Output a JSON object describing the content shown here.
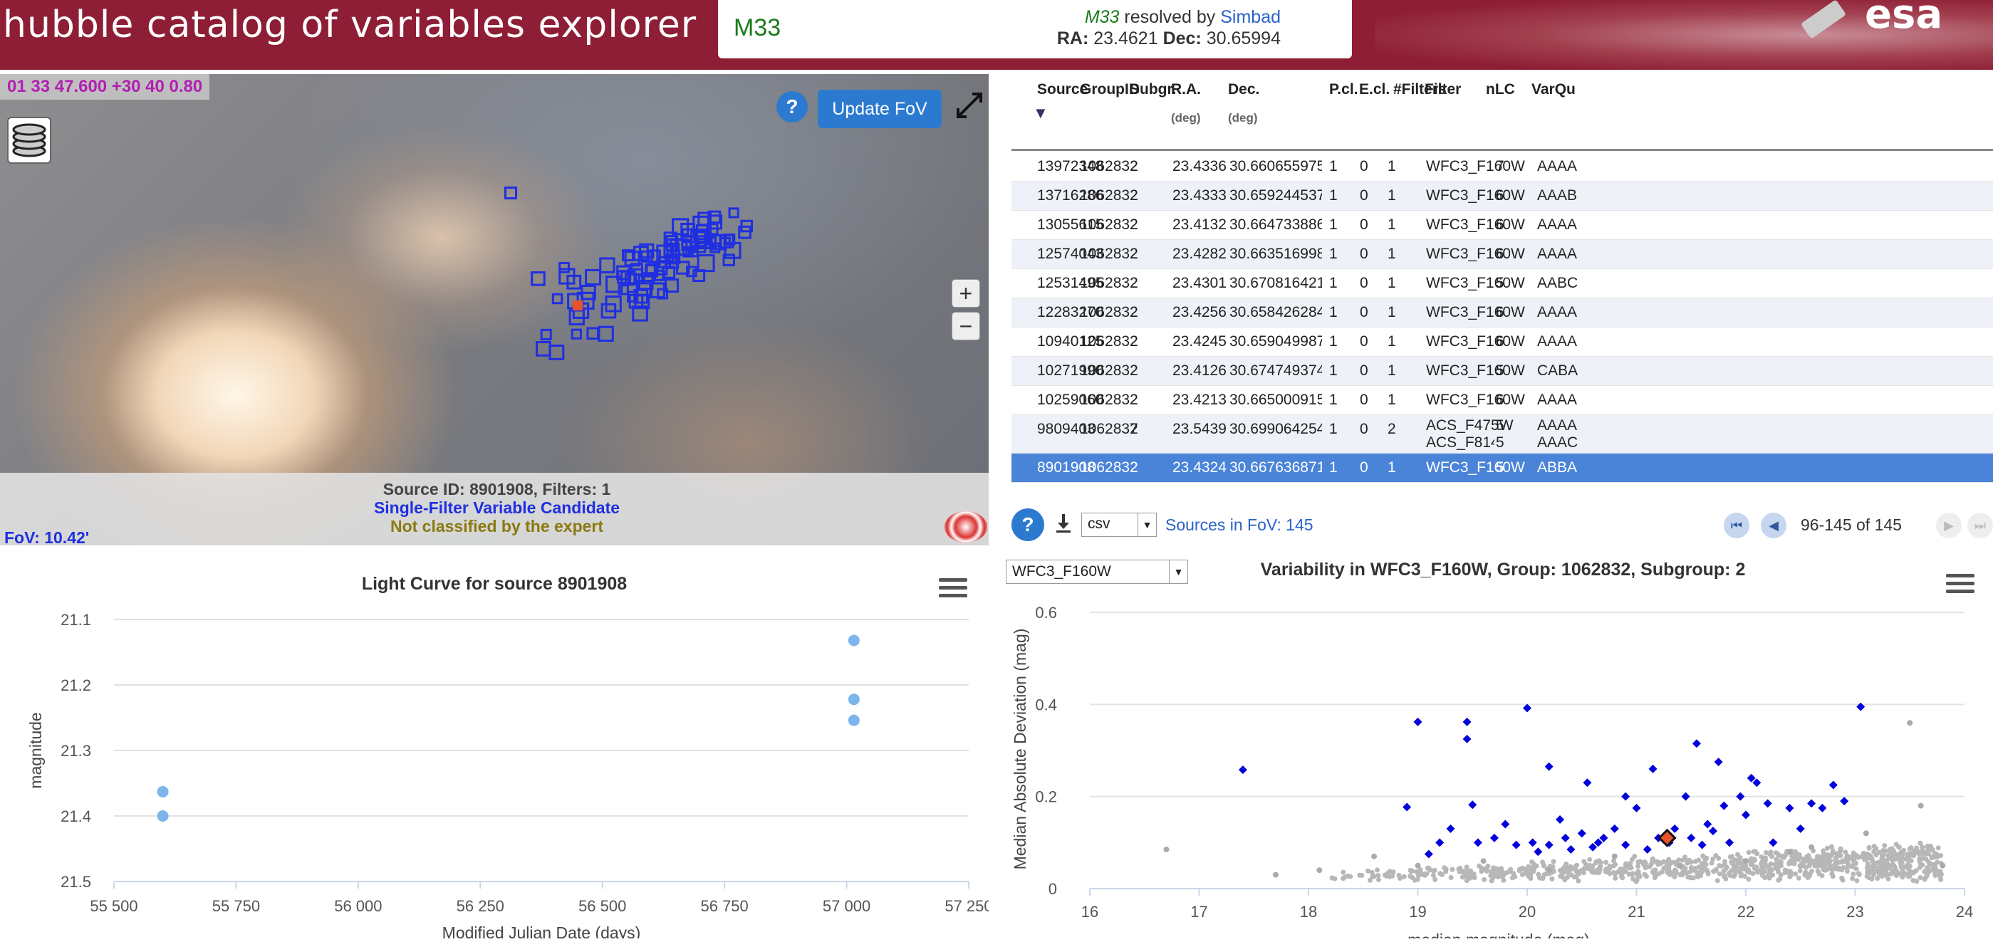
{
  "header": {
    "app_title": "hubble catalog of variables explorer",
    "search_value": "M33",
    "resolver_object": "M33",
    "resolver_text": "resolved by",
    "resolver_service": "Simbad",
    "ra_label": "RA:",
    "ra_value": "23.4621",
    "dec_label": "Dec:",
    "dec_value": "30.65994",
    "logo_text": "esa"
  },
  "sky_view": {
    "coordinates": "01 33 47.600 +30 40 0.80",
    "help_label": "?",
    "update_fov_label": "Update FoV",
    "zoom_in_label": "+",
    "zoom_out_label": "−",
    "source_info_line1": "Source ID: 8901908, Filters: 1",
    "source_info_line2": "Single-Filter Variable Candidate",
    "source_info_line3": "Not classified by the expert",
    "fov": "FoV: 10.42'"
  },
  "table": {
    "columns": [
      {
        "label": "Source",
        "unit": ""
      },
      {
        "label": "GroupID",
        "unit": ""
      },
      {
        "label": "Subgr.",
        "unit": ""
      },
      {
        "label": "R.A.",
        "unit": "(deg)"
      },
      {
        "label": "Dec.",
        "unit": "(deg)"
      },
      {
        "label": "P.cl.",
        "unit": ""
      },
      {
        "label": "E.cl.",
        "unit": ""
      },
      {
        "label": "#Filters",
        "unit": ""
      },
      {
        "label": "Filter",
        "unit": ""
      },
      {
        "label": "nLC",
        "unit": ""
      },
      {
        "label": "VarQu",
        "unit": ""
      }
    ],
    "rows": [
      {
        "source": "13972348",
        "group": "1062832",
        "subgr": "2",
        "ra": "23.4336471558",
        "dec": "30.6606559753",
        "pcl": "1",
        "ecl": "0",
        "nfilters": "1",
        "filter": "WFC3_F160W",
        "nlc": "7",
        "varqu": "AAAA"
      },
      {
        "source": "13716286",
        "group": "1062832",
        "subgr": "2",
        "ra": "23.4333209991",
        "dec": "30.6592445374",
        "pcl": "1",
        "ecl": "0",
        "nfilters": "1",
        "filter": "WFC3_F160W",
        "nlc": "6",
        "varqu": "AAAB"
      },
      {
        "source": "13055615",
        "group": "1062832",
        "subgr": "2",
        "ra": "23.4132061005",
        "dec": "30.6647338867",
        "pcl": "1",
        "ecl": "0",
        "nfilters": "1",
        "filter": "WFC3_F160W",
        "nlc": "6",
        "varqu": "AAAA"
      },
      {
        "source": "12574043",
        "group": "1062832",
        "subgr": "2",
        "ra": "23.4282131195",
        "dec": "30.6635169983",
        "pcl": "1",
        "ecl": "0",
        "nfilters": "1",
        "filter": "WFC3_F160W",
        "nlc": "6",
        "varqu": "AAAA"
      },
      {
        "source": "12531495",
        "group": "1062832",
        "subgr": "2",
        "ra": "23.4301815033",
        "dec": "30.6708164215",
        "pcl": "1",
        "ecl": "0",
        "nfilters": "1",
        "filter": "WFC3_F160W",
        "nlc": "5",
        "varqu": "AABC"
      },
      {
        "source": "12283270",
        "group": "1062832",
        "subgr": "2",
        "ra": "23.4256610870",
        "dec": "30.6584262848",
        "pcl": "1",
        "ecl": "0",
        "nfilters": "1",
        "filter": "WFC3_F160W",
        "nlc": "6",
        "varqu": "AAAA"
      },
      {
        "source": "10940125",
        "group": "1062832",
        "subgr": "2",
        "ra": "23.4245777130",
        "dec": "30.6590499878",
        "pcl": "1",
        "ecl": "0",
        "nfilters": "1",
        "filter": "WFC3_F160W",
        "nlc": "6",
        "varqu": "AAAA"
      },
      {
        "source": "10271990",
        "group": "1062832",
        "subgr": "2",
        "ra": "23.4126739502",
        "dec": "30.6747493744",
        "pcl": "1",
        "ecl": "0",
        "nfilters": "1",
        "filter": "WFC3_F160W",
        "nlc": "5",
        "varqu": "CABA"
      },
      {
        "source": "10259060",
        "group": "1062832",
        "subgr": "2",
        "ra": "23.4213886261",
        "dec": "30.6650009155",
        "pcl": "1",
        "ecl": "0",
        "nfilters": "1",
        "filter": "WFC3_F160W",
        "nlc": "6",
        "varqu": "AAAA"
      },
      {
        "source": "9809403",
        "group": "1062832",
        "subgr": "7",
        "ra": "23.5439643860",
        "dec": "30.6990642548",
        "pcl": "1",
        "ecl": "0",
        "nfilters": "2",
        "filter": "ACS_F475W",
        "filter2": "ACS_F814W",
        "nlc": "5",
        "nlc2": "5",
        "varqu": "AAAA",
        "varqu2": "AAAC"
      },
      {
        "source": "8901908",
        "group": "1062832",
        "subgr": "2",
        "ra": "23.4324779510",
        "dec": "30.6676368713",
        "pcl": "1",
        "ecl": "0",
        "nfilters": "1",
        "filter": "WFC3_F160W",
        "nlc": "5",
        "varqu": "ABBA"
      }
    ],
    "format_value": "csv",
    "sources_in_fov": "Sources in FoV: 145",
    "pager": "96-145 of 145"
  },
  "light_curve": {
    "title": "Light Curve for source 8901908",
    "xlabel": "Modified Julian Date (days)",
    "ylabel": "magnitude"
  },
  "variability": {
    "filter_value": "WFC3_F160W",
    "title": "Variability in WFC3_F160W, Group: 1062832, Subgroup: 2",
    "xlabel": "median magnitude (mag)",
    "ylabel": "Median Absolute Deviation (mag)"
  },
  "colors": {
    "header_bg": "#8e1e35",
    "accent": "#2c7ad0",
    "selected_row": "#4a84d8",
    "lc_points": "#7cb5ec",
    "variable_points": "#0000dd",
    "field_points": "#aaaaaa",
    "highlight_point": "#e8532b"
  },
  "chart_data": [
    {
      "type": "scatter",
      "title": "Light Curve for source 8901908",
      "xlabel": "Modified Julian Date (days)",
      "ylabel": "magnitude",
      "xlim": [
        55500,
        57250
      ],
      "ylim": [
        21.5,
        21.1
      ],
      "y_reversed": true,
      "x_ticks": [
        55500,
        55750,
        56000,
        56250,
        56500,
        56750,
        57000,
        57250
      ],
      "x_tick_labels": [
        "55 500",
        "55 750",
        "56 000",
        "56 250",
        "56 500",
        "56 750",
        "57 000",
        "57 250"
      ],
      "y_ticks": [
        21.1,
        21.2,
        21.3,
        21.4,
        21.5
      ],
      "series": [
        {
          "x": [
            55600,
            55600,
            57015,
            57015,
            57015
          ],
          "y": [
            21.363,
            21.4,
            21.132,
            21.222,
            21.254
          ]
        }
      ]
    },
    {
      "type": "scatter",
      "title": "Variability in WFC3_F160W, Group: 1062832, Subgroup: 2",
      "xlabel": "median magnitude (mag)",
      "ylabel": "Median Absolute Deviation (mag)",
      "xlim": [
        16,
        24
      ],
      "ylim": [
        0,
        0.6
      ],
      "x_ticks": [
        16,
        17,
        18,
        19,
        20,
        21,
        22,
        23,
        24
      ],
      "y_ticks": [
        0,
        0.2,
        0.4,
        0.6
      ],
      "series": [
        {
          "points": [
            [
              17.4,
              0.258
            ],
            [
              18.9,
              0.177
            ],
            [
              19.0,
              0.362
            ],
            [
              19.1,
              0.075
            ],
            [
              19.2,
              0.1
            ],
            [
              19.3,
              0.13
            ],
            [
              19.45,
              0.362
            ],
            [
              19.45,
              0.325
            ],
            [
              19.5,
              0.182
            ],
            [
              19.55,
              0.1
            ],
            [
              19.7,
              0.11
            ],
            [
              19.8,
              0.14
            ],
            [
              19.9,
              0.095
            ],
            [
              20.0,
              0.392
            ],
            [
              20.05,
              0.1
            ],
            [
              20.1,
              0.08
            ],
            [
              20.2,
              0.095
            ],
            [
              20.3,
              0.15
            ],
            [
              20.35,
              0.11
            ],
            [
              20.4,
              0.085
            ],
            [
              20.5,
              0.12
            ],
            [
              20.6,
              0.09
            ],
            [
              20.65,
              0.1
            ],
            [
              20.7,
              0.11
            ],
            [
              20.8,
              0.13
            ],
            [
              20.9,
              0.095
            ],
            [
              21.0,
              0.175
            ],
            [
              21.1,
              0.085
            ],
            [
              21.2,
              0.11
            ],
            [
              21.3,
              0.1
            ],
            [
              21.35,
              0.13
            ],
            [
              21.45,
              0.2
            ],
            [
              21.5,
              0.11
            ],
            [
              21.6,
              0.095
            ],
            [
              21.65,
              0.14
            ],
            [
              21.7,
              0.125
            ],
            [
              21.8,
              0.18
            ],
            [
              21.85,
              0.1
            ],
            [
              21.95,
              0.2
            ],
            [
              22.0,
              0.16
            ],
            [
              22.1,
              0.23
            ],
            [
              22.2,
              0.185
            ],
            [
              22.25,
              0.1
            ],
            [
              22.4,
              0.175
            ],
            [
              22.5,
              0.13
            ],
            [
              22.6,
              0.185
            ],
            [
              22.7,
              0.175
            ],
            [
              22.8,
              0.225
            ],
            [
              22.9,
              0.19
            ],
            [
              23.05,
              0.395
            ],
            [
              20.9,
              0.2
            ],
            [
              21.55,
              0.315
            ],
            [
              21.75,
              0.275
            ],
            [
              22.05,
              0.24
            ],
            [
              21.15,
              0.26
            ],
            [
              20.2,
              0.265
            ],
            [
              20.55,
              0.23
            ]
          ]
        },
        {
          "points": [
            [
              16.7,
              0.085
            ],
            [
              17.7,
              0.03
            ],
            [
              18.1,
              0.04
            ],
            [
              18.6,
              0.07
            ],
            [
              19.0,
              0.05
            ],
            [
              19.6,
              0.06
            ],
            [
              20.2,
              0.04
            ],
            [
              20.8,
              0.07
            ],
            [
              21.4,
              0.05
            ],
            [
              22.0,
              0.06
            ],
            [
              22.6,
              0.09
            ],
            [
              23.1,
              0.12
            ],
            [
              23.5,
              0.36
            ],
            [
              23.6,
              0.18
            ],
            [
              23.8,
              0.05
            ],
            [
              22.4,
              0.08
            ]
          ]
        },
        {
          "points": [
            [
              21.28,
              0.11
            ]
          ]
        }
      ]
    }
  ]
}
